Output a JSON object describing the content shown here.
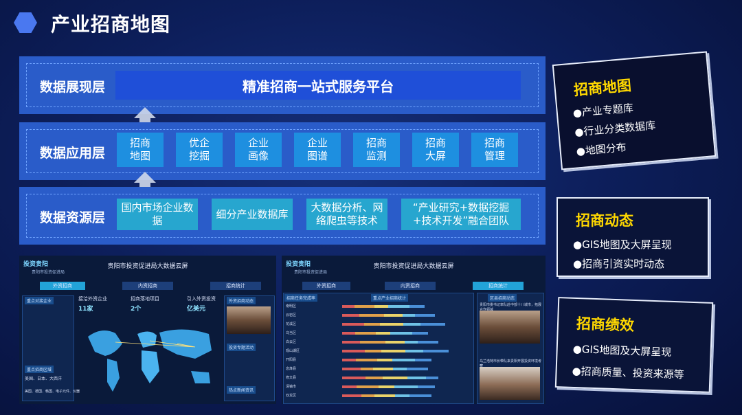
{
  "header": {
    "title": "产业招商地图"
  },
  "layers": {
    "presentation": {
      "label": "数据展现层",
      "platform": "精准招商一站式服务平台"
    },
    "application": {
      "label": "数据应用层",
      "items": [
        "招商\n地图",
        "优企\n挖掘",
        "企业\n画像",
        "企业\n图谱",
        "招商\n监测",
        "招商\n大屏",
        "招商\n管理"
      ]
    },
    "resource": {
      "label": "数据资源层",
      "items": [
        "国内市场企业数据",
        "细分产业数据库",
        "大数据分析、网络爬虫等技术",
        "“产业研究+数据挖掘+技术开发”融合团队"
      ]
    }
  },
  "screens": {
    "left": {
      "title": "贵阳市投资促进局大数据云屏",
      "logo": "投资贵阳",
      "logo_sub": "贵阳市投资促进局",
      "nav": [
        "外资招商",
        "内资招商",
        "招商统计"
      ],
      "stats": [
        {
          "label": "接洽外资企业",
          "value": "11家"
        },
        {
          "label": "招商落地项目",
          "value": "2个"
        },
        {
          "label": "引入外资投资",
          "value": "亿美元"
        }
      ],
      "panels": {
        "left_top": "重点对接企业",
        "left_bottom": "重点招商区域",
        "right_top": "外资招商动态",
        "right_mid": "投资专题活动",
        "right_bottom": "热点新闻资讯"
      },
      "side_text": "美国、日本、大西洋",
      "side_text2": "美国、德国、韩国、电子元件、仪器"
    },
    "right": {
      "title": "贵阳市投资促进局大数据云屏",
      "logo": "投资贵阳",
      "logo_sub": "贵阳市投资促进局",
      "nav": [
        "外资招商",
        "内资招商",
        "招商统计"
      ],
      "table_title": "招商任务完成率",
      "chart_title": "重点产业招商统计",
      "news_title": "区县招商动态",
      "cities": [
        "南明区",
        "云岩区",
        "花溪区",
        "乌当区",
        "白云区",
        "观山湖区",
        "开阳县",
        "息烽县",
        "修文县",
        "清镇市",
        "双龙区"
      ],
      "news1": "贵阳市委书记率队赴中部十八城市，拓展合作领域",
      "news2": "乌兰浩特市长带队来贵阳开展投资环境考察"
    }
  },
  "cards": [
    {
      "title": "招商地图",
      "items": [
        "●产业专题库",
        "●行业分类数据库",
        "●地图分布"
      ]
    },
    {
      "title": "招商动态",
      "items": [
        "●GIS地图及大屏呈现",
        "●招商引资实时动态"
      ]
    },
    {
      "title": "招商绩效",
      "items": [
        "●GIS地图及大屏呈现",
        "●招商质量、投资来源等"
      ]
    }
  ],
  "colors": {
    "accent": "#ffd800",
    "layer": "#2a5cc9",
    "platform": "#1f4fd8",
    "app": "#1e8fe0",
    "resource": "#27a6cf"
  },
  "icons": [
    "hexagon-icon",
    "up-arrow-icon"
  ]
}
